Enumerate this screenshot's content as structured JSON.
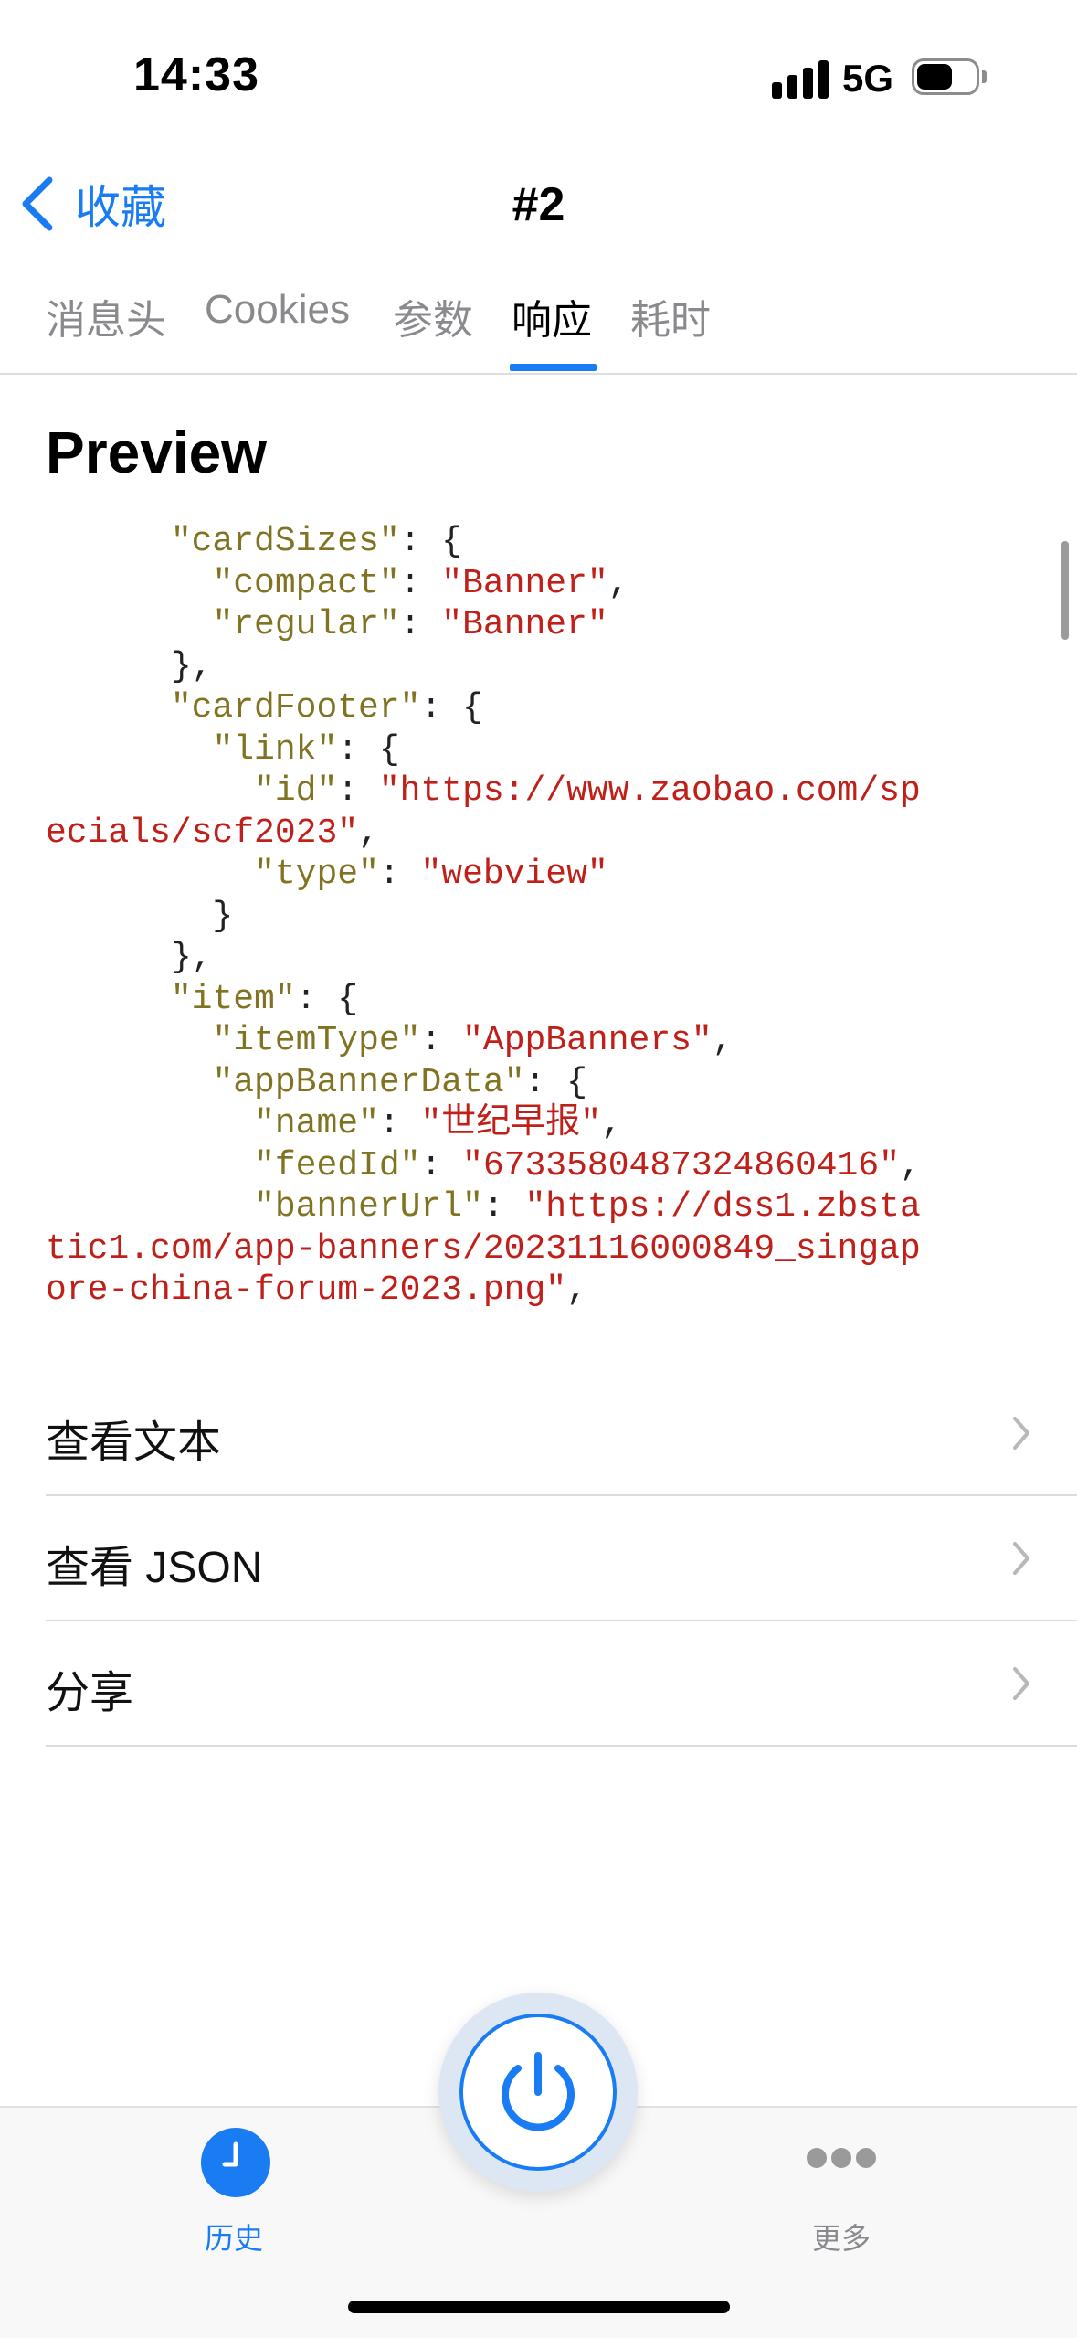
{
  "status_bar": {
    "time": "14:33",
    "network": "5G"
  },
  "nav": {
    "back_label": "收藏",
    "title": "#2"
  },
  "tabs": [
    {
      "label": "消息头",
      "active": false
    },
    {
      "label": "Cookies",
      "active": false
    },
    {
      "label": "参数",
      "active": false
    },
    {
      "label": "响应",
      "active": true
    },
    {
      "label": "耗时",
      "active": false
    }
  ],
  "preview": {
    "title": "Preview",
    "json_lines": [
      [
        {
          "t": "      ",
          "c": "p"
        },
        {
          "t": "\"cardSizes\"",
          "c": "k"
        },
        {
          "t": ": {",
          "c": "p"
        }
      ],
      [
        {
          "t": "        ",
          "c": "p"
        },
        {
          "t": "\"compact\"",
          "c": "k"
        },
        {
          "t": ": ",
          "c": "p"
        },
        {
          "t": "\"Banner\"",
          "c": "s"
        },
        {
          "t": ",",
          "c": "p"
        }
      ],
      [
        {
          "t": "        ",
          "c": "p"
        },
        {
          "t": "\"regular\"",
          "c": "k"
        },
        {
          "t": ": ",
          "c": "p"
        },
        {
          "t": "\"Banner\"",
          "c": "s"
        }
      ],
      [
        {
          "t": "      },",
          "c": "p"
        }
      ],
      [
        {
          "t": "      ",
          "c": "p"
        },
        {
          "t": "\"cardFooter\"",
          "c": "k"
        },
        {
          "t": ": {",
          "c": "p"
        }
      ],
      [
        {
          "t": "        ",
          "c": "p"
        },
        {
          "t": "\"link\"",
          "c": "k"
        },
        {
          "t": ": {",
          "c": "p"
        }
      ],
      [
        {
          "t": "          ",
          "c": "p"
        },
        {
          "t": "\"id\"",
          "c": "k"
        },
        {
          "t": ": ",
          "c": "p"
        },
        {
          "t": "\"https://www.zaobao.com/sp",
          "c": "s"
        }
      ],
      [
        {
          "t": "ecials/scf2023\"",
          "c": "s"
        },
        {
          "t": ",",
          "c": "p"
        }
      ],
      [
        {
          "t": "          ",
          "c": "p"
        },
        {
          "t": "\"type\"",
          "c": "k"
        },
        {
          "t": ": ",
          "c": "p"
        },
        {
          "t": "\"webview\"",
          "c": "s"
        }
      ],
      [
        {
          "t": "        }",
          "c": "p"
        }
      ],
      [
        {
          "t": "      },",
          "c": "p"
        }
      ],
      [
        {
          "t": "      ",
          "c": "p"
        },
        {
          "t": "\"item\"",
          "c": "k"
        },
        {
          "t": ": {",
          "c": "p"
        }
      ],
      [
        {
          "t": "        ",
          "c": "p"
        },
        {
          "t": "\"itemType\"",
          "c": "k"
        },
        {
          "t": ": ",
          "c": "p"
        },
        {
          "t": "\"AppBanners\"",
          "c": "s"
        },
        {
          "t": ",",
          "c": "p"
        }
      ],
      [
        {
          "t": "        ",
          "c": "p"
        },
        {
          "t": "\"appBannerData\"",
          "c": "k"
        },
        {
          "t": ": {",
          "c": "p"
        }
      ],
      [
        {
          "t": "          ",
          "c": "p"
        },
        {
          "t": "\"name\"",
          "c": "k"
        },
        {
          "t": ": ",
          "c": "p"
        },
        {
          "t": "\"世纪早报\"",
          "c": "s"
        },
        {
          "t": ",",
          "c": "p"
        }
      ],
      [
        {
          "t": "          ",
          "c": "p"
        },
        {
          "t": "\"feedId\"",
          "c": "k"
        },
        {
          "t": ": ",
          "c": "p"
        },
        {
          "t": "\"6733580487324860416\"",
          "c": "s"
        },
        {
          "t": ",",
          "c": "p"
        }
      ],
      [
        {
          "t": "          ",
          "c": "p"
        },
        {
          "t": "\"bannerUrl\"",
          "c": "k"
        },
        {
          "t": ": ",
          "c": "p"
        },
        {
          "t": "\"https://dss1.zbsta",
          "c": "s"
        }
      ],
      [
        {
          "t": "tic1.com/app-banners/20231116000849_singap",
          "c": "s"
        }
      ],
      [
        {
          "t": "ore-china-forum-2023.png\"",
          "c": "s"
        },
        {
          "t": ",",
          "c": "p"
        }
      ]
    ]
  },
  "actions": [
    {
      "label": "查看文本"
    },
    {
      "label": "查看 JSON"
    },
    {
      "label": "分享"
    }
  ],
  "tabbar": {
    "history_label": "历史",
    "more_label": "更多"
  },
  "colors": {
    "accent": "#1a7cf2",
    "json_key": "#807321",
    "json_string": "#c0201a"
  }
}
